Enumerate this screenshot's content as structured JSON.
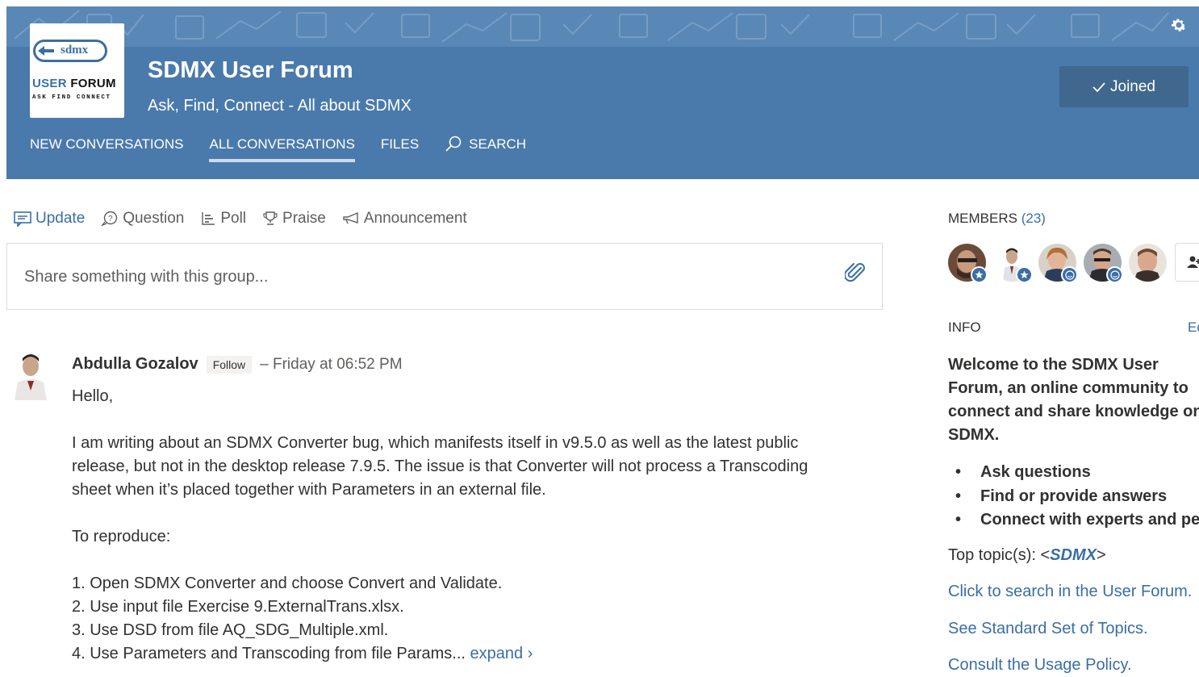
{
  "header": {
    "group_name": "SDMX User Forum",
    "tagline": "Ask, Find, Connect - All about SDMX",
    "logo": {
      "badge": "sdmx",
      "title_user": "USER",
      "title_forum": "FORUM",
      "tagline": "ASK FIND CONNECT"
    },
    "joined_label": "Joined",
    "settings_icon": "gear-icon",
    "nav": [
      {
        "label": "NEW CONVERSATIONS"
      },
      {
        "label": "ALL CONVERSATIONS",
        "active": true
      },
      {
        "label": "FILES"
      },
      {
        "label": "SEARCH",
        "icon": "search-icon"
      }
    ],
    "colors": {
      "banner": "#4a7aab",
      "banner_band": "#5a88b6",
      "joined_button": "#40688f"
    }
  },
  "publisher": {
    "tabs": [
      {
        "label": "Update",
        "icon": "update-icon",
        "active": true
      },
      {
        "label": "Question",
        "icon": "question-icon"
      },
      {
        "label": "Poll",
        "icon": "poll-icon"
      },
      {
        "label": "Praise",
        "icon": "trophy-icon"
      },
      {
        "label": "Announcement",
        "icon": "megaphone-icon"
      }
    ],
    "placeholder": "Share something with this group...",
    "attach_icon": "paperclip-icon"
  },
  "post": {
    "author": "Abdulla Gozalov",
    "follow_label": "Follow",
    "time": "– Friday at 06:52 PM",
    "greeting": "Hello,",
    "paragraph": "I am writing about an SDMX Converter bug, which manifests itself in v9.5.0 as well as the latest public release, but not in the desktop release 7.9.5. The issue is that Converter will not process a Transcoding sheet when it’s placed together with Parameters in an external file.",
    "reproduce": "To reproduce:",
    "steps": [
      "1. Open SDMX Converter and choose Convert and Validate.",
      "2. Use input file Exercise 9.ExternalTrans.xlsx.",
      "3. Use DSD from file AQ_SDG_Multiple.xml.",
      "4. Use Parameters and Transcoding from file Params..."
    ],
    "expand_label": "expand ›"
  },
  "sidebar": {
    "members_label": "MEMBERS",
    "members_count": "(23)",
    "info_label": "INFO",
    "edit_label": "Edit",
    "welcome_lines": [
      "Welcome to the SDMX User",
      "Forum, an online community to",
      "connect and share knowledge on",
      "SDMX."
    ],
    "bullets": [
      "Ask questions",
      "Find or provide answers",
      "Connect with experts and peers"
    ],
    "top_topics_prefix": "Top topic(s): <",
    "top_topic": "SDMX",
    "top_topics_suffix": ">",
    "links": [
      "Click to search in the User Forum.",
      "See Standard Set of Topics.",
      "Consult the Usage Policy."
    ]
  }
}
